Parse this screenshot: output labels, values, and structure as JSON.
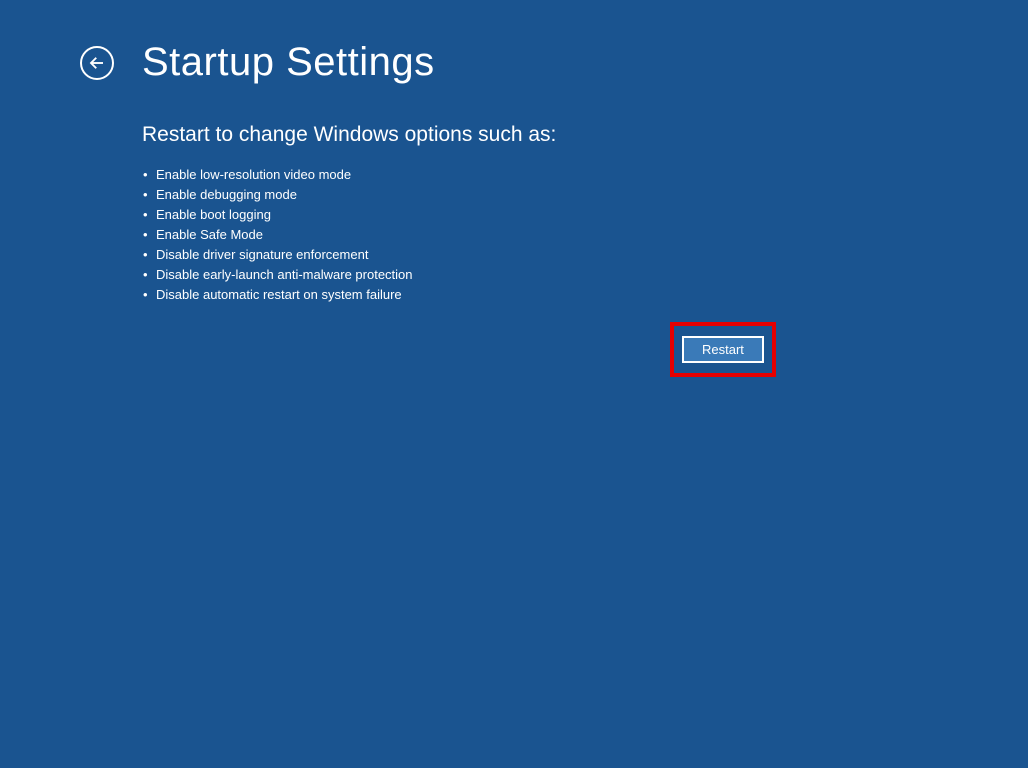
{
  "header": {
    "title": "Startup Settings"
  },
  "main": {
    "subtitle": "Restart to change Windows options such as:",
    "options": [
      "Enable low-resolution video mode",
      "Enable debugging mode",
      "Enable boot logging",
      "Enable Safe Mode",
      "Disable driver signature enforcement",
      "Disable early-launch anti-malware protection",
      "Disable automatic restart on system failure"
    ]
  },
  "actions": {
    "restart_label": "Restart"
  }
}
